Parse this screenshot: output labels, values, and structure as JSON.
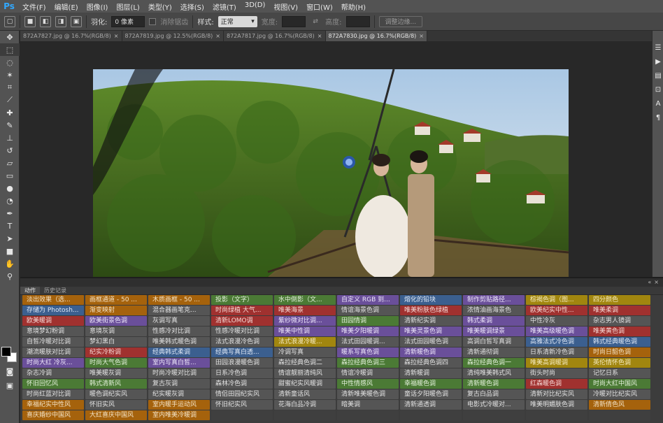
{
  "app": {
    "logo": "Ps"
  },
  "menu": [
    "文件(F)",
    "编辑(E)",
    "图像(I)",
    "图层(L)",
    "类型(Y)",
    "选择(S)",
    "滤镜(T)",
    "3D(D)",
    "视图(V)",
    "窗口(W)",
    "帮助(H)"
  ],
  "options": {
    "feather_label": "羽化:",
    "feather_value": "0 像素",
    "antialias_label": "消除锯齿",
    "style_label": "样式:",
    "style_value": "正常",
    "width_label": "宽度:",
    "height_label": "高度:",
    "refine_button": "调整边缘..."
  },
  "doc_tabs": [
    {
      "label": "872A7827.jpg @ 16.7%(RGB/8)",
      "active": false
    },
    {
      "label": "872A7819.jpg @ 12.5%(RGB/8)",
      "active": false
    },
    {
      "label": "872A7817.jpg @ 16.7%(RGB/8)",
      "active": false
    },
    {
      "label": "872A7830.jpg @ 16.7%(RGB/8)",
      "active": true
    }
  ],
  "panel": {
    "tabs": [
      "动作",
      "历史记录"
    ],
    "actions": [
      [
        "淡出效果（选...",
        "orange"
      ],
      [
        "画框通道 - 50 ...",
        "orange"
      ],
      [
        "木质画框 - 50 ...",
        "orange"
      ],
      [
        "投影（文字）",
        "green"
      ],
      [
        "水中倒影（文...",
        "green"
      ],
      [
        "自定义 RGB 到...",
        "purple"
      ],
      [
        "熔化的铅块",
        "blue"
      ],
      [
        "制作剪贴路径...",
        "purple"
      ],
      [
        "棕褐色调（图...",
        "yellow"
      ],
      [
        "四分颜色",
        "yellow"
      ],
      [
        "存储为 Photosh...",
        "blue"
      ],
      [
        "渐变映射",
        "orange"
      ],
      [
        "混合器画笔克...",
        "gray"
      ],
      [
        "时尚绿植 大气...",
        "red"
      ],
      [
        "唯美海景",
        "red"
      ],
      [
        "情谊海景色调",
        "gray"
      ],
      [
        "唯美粉肤色绿植",
        "red"
      ],
      [
        "浓情油画海景色",
        "gray"
      ],
      [
        "欧美纪实中性...",
        "red"
      ],
      [
        "唯美柔调",
        "red"
      ],
      [
        "欧美暖调",
        "red"
      ],
      [
        "欧美街景色调",
        "purple"
      ],
      [
        "灰调写真",
        "gray"
      ],
      [
        "清新LOMO调",
        "red"
      ],
      [
        "紫纱微对比调...",
        "purple"
      ],
      [
        "田园情调",
        "green"
      ],
      [
        "清新纪实调",
        "gray"
      ],
      [
        "韩式柔调",
        "purple"
      ],
      [
        "中性冷灰",
        "gray"
      ],
      [
        "杂志男人镜调",
        "gray"
      ],
      [
        "意境梦幻粉调",
        "gray"
      ],
      [
        "意境灰调",
        "gray"
      ],
      [
        "性感冷对比调",
        "gray"
      ],
      [
        "性感冷暖对比调",
        "gray"
      ],
      [
        "唯美中性调",
        "purple"
      ],
      [
        "唯美夕阳暖调",
        "purple"
      ],
      [
        "唯美灵景色调",
        "purple"
      ],
      [
        "唯美暖调绿景",
        "purple"
      ],
      [
        "唯美高级暖色调",
        "purple"
      ],
      [
        "唯美黄色调",
        "red"
      ],
      [
        "自皙冷暖对比调",
        "gray"
      ],
      [
        "梦幻黑白",
        "gray"
      ],
      [
        "唯美韩式暖色调",
        "gray"
      ],
      [
        "法式浪漫冷色调",
        "gray"
      ],
      [
        "法式浪漫冷暖...",
        "yellow"
      ],
      [
        "法式田园暖调...",
        "gray"
      ],
      [
        "法式田园暖色调",
        "gray"
      ],
      [
        "高调白皙写真调",
        "gray"
      ],
      [
        "高雅法式冷色调",
        "blue"
      ],
      [
        "韩式经典暖色调",
        "blue"
      ],
      [
        "潮流暖肤对比调",
        "gray"
      ],
      [
        "纪实冷粉调",
        "red"
      ],
      [
        "经典韩式柔调",
        "blue"
      ],
      [
        "经典写真白透...",
        "blue"
      ],
      [
        "冷调写真",
        "gray"
      ],
      [
        "暖系写真色调",
        "purple"
      ],
      [
        "清新暖色调",
        "purple"
      ],
      [
        "清新通彻调",
        "gray"
      ],
      [
        "日系清新冷色调",
        "gray"
      ],
      [
        "时尚日韶色调",
        "orange"
      ],
      [
        "时尚大红 冷灰...",
        "purple"
      ],
      [
        "时尚大气色调",
        "green"
      ],
      [
        "室内写真白皙...",
        "purple"
      ],
      [
        "田园浪漫暖色调",
        "gray"
      ],
      [
        "森拉经典色调二",
        "gray"
      ],
      [
        "森拉经典色调三",
        "green"
      ],
      [
        "森拉经典色调四",
        "gray"
      ],
      [
        "森拉经典色调一",
        "green"
      ],
      [
        "唯美高调暖调",
        "yellow"
      ],
      [
        "英伦情怀色调",
        "yellow"
      ],
      [
        "杂志冷调",
        "gray"
      ],
      [
        "唯美暖灰调",
        "gray"
      ],
      [
        "时尚冷暖对比调",
        "gray"
      ],
      [
        "日系冷色调",
        "gray"
      ],
      [
        "情谊靓丽清纯风",
        "gray"
      ],
      [
        "情谊冷暖调",
        "gray"
      ],
      [
        "清新暖调",
        "gray"
      ],
      [
        "清纯唯美韩式风",
        "gray"
      ],
      [
        "街头时尚",
        "gray"
      ],
      [
        "记忆日系",
        "gray"
      ],
      [
        "怀旧回忆风",
        "green"
      ],
      [
        "韩式清新风",
        "green"
      ],
      [
        "复古灰调",
        "gray"
      ],
      [
        "森林冷色调",
        "gray"
      ],
      [
        "甜蜜纪实风暖调",
        "gray"
      ],
      [
        "中性情感风",
        "green"
      ],
      [
        "幸福暖色调",
        "green"
      ],
      [
        "清新暖色调",
        "green"
      ],
      [
        "红森暖色调",
        "red"
      ],
      [
        "时尚大红中国风",
        "green"
      ],
      [
        "时尚红蓝对比调",
        "gray"
      ],
      [
        "暖色调纪实风",
        "gray"
      ],
      [
        "纪实暖灰调",
        "gray"
      ],
      [
        "情侣田园纪实风",
        "gray"
      ],
      [
        "清新童话风",
        "gray"
      ],
      [
        "清新唯美暖色调",
        "gray"
      ],
      [
        "童话夕阳暖色调",
        "gray"
      ],
      [
        "复古白品调",
        "gray"
      ],
      [
        "清新对比纪实风",
        "gray"
      ],
      [
        "冷暖对比纪实风",
        "gray"
      ],
      [
        "幸福纪实中性风",
        "orange"
      ],
      [
        "怀旧实风",
        "gray"
      ],
      [
        "室内暖手运动风",
        "orange"
      ],
      [
        "怀旧纪实风",
        "gray"
      ],
      [
        "花海白品冷调",
        "gray"
      ],
      [
        "暗美调",
        "gray"
      ],
      [
        "清新通透调",
        "gray"
      ],
      [
        "电影式冷暖对...",
        "gray"
      ],
      [
        "唯美明媚肤色调",
        "gray"
      ],
      [
        "清新倩色风",
        "orange"
      ],
      [
        "喜庆婚纱中国风",
        "orange"
      ],
      [
        "大红喜庆中国风",
        "orange"
      ],
      [
        "室内唯美冷暖调",
        "orange"
      ],
      [
        "",
        "empty"
      ],
      [
        "",
        "empty"
      ],
      [
        "",
        "empty"
      ],
      [
        "",
        "empty"
      ],
      [
        "",
        "empty"
      ],
      [
        "",
        "empty"
      ],
      [
        "",
        "empty"
      ]
    ]
  }
}
